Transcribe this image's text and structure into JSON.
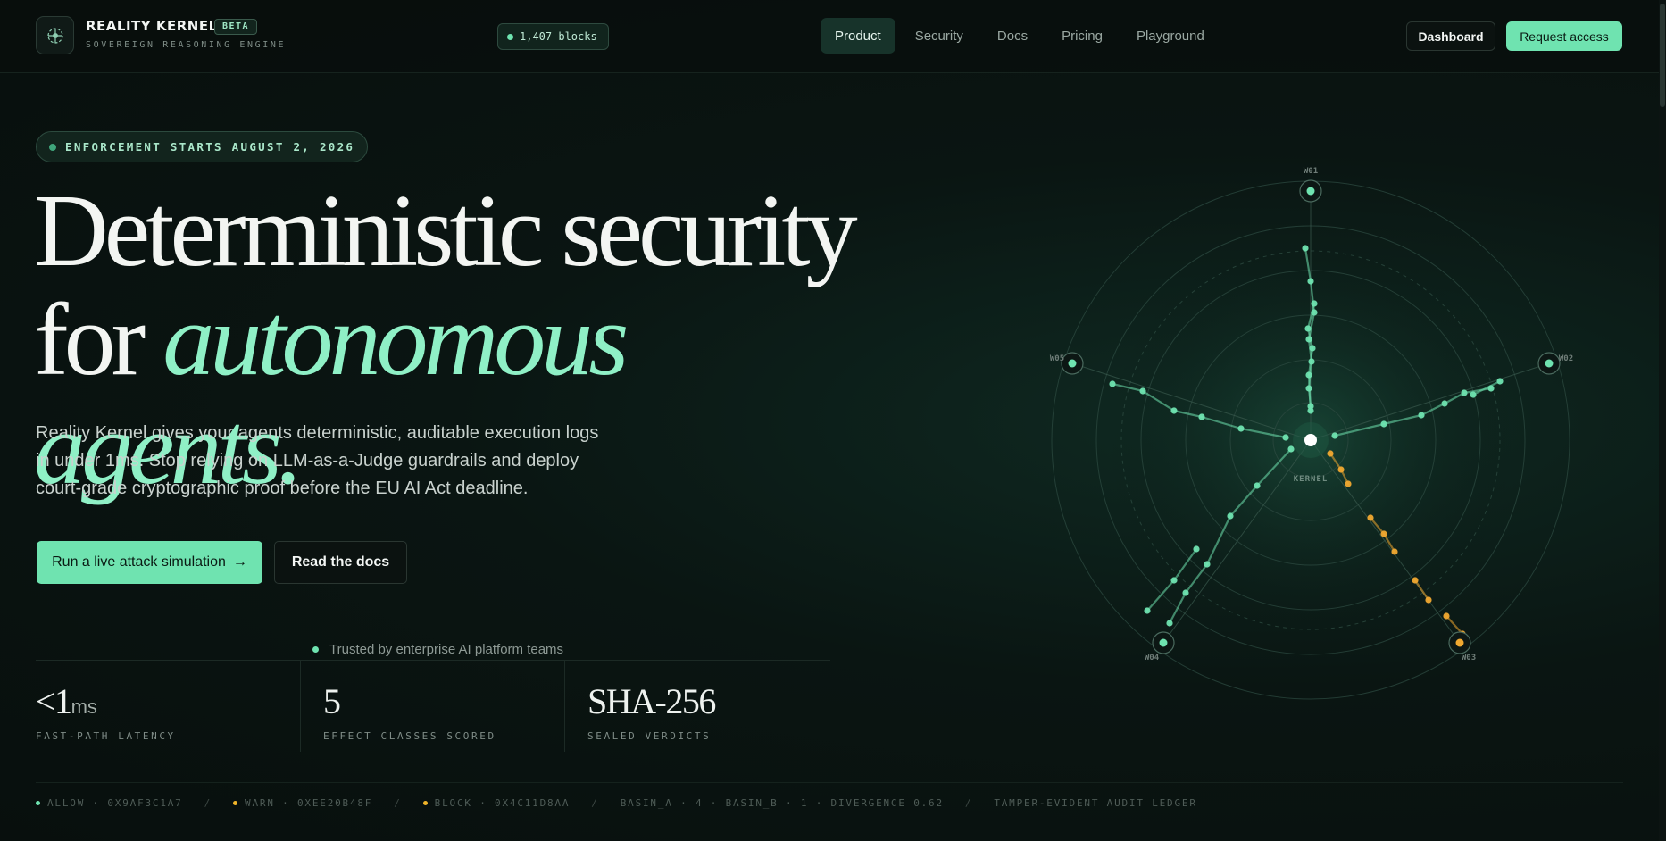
{
  "header": {
    "brand": "REALITY KERNEL",
    "beta": "BETA",
    "tagline": "SOVEREIGN REASONING ENGINE",
    "blocks": "1,407 blocks",
    "nav": [
      {
        "label": "Product",
        "active": true
      },
      {
        "label": "Security",
        "active": false
      },
      {
        "label": "Docs",
        "active": false
      },
      {
        "label": "Pricing",
        "active": false
      },
      {
        "label": "Playground",
        "active": false
      }
    ],
    "dashboard_label": "Dashboard",
    "request_label": "Request access"
  },
  "hero": {
    "badge": "ENFORCEMENT STARTS AUGUST 2, 2026",
    "headline_line1": "Deterministic security",
    "headline_for": "for ",
    "headline_accent": "autonomous agents.",
    "lead": "Reality Kernel gives your agents deterministic, auditable execution logs in under 1ms. Stop relying on LLM-as-a-Judge guardrails and deploy court-grade cryptographic proof before the EU AI Act deadline.",
    "cta_primary": "Run a live attack simulation",
    "cta_primary_arrow": "→",
    "cta_secondary": "Read the docs",
    "trusted": "Trusted by enterprise AI platform teams"
  },
  "stats": [
    {
      "value": "<1",
      "unit": "ms",
      "label": "FAST-PATH LATENCY"
    },
    {
      "value": "5",
      "unit": "",
      "label": "EFFECT CLASSES SCORED"
    },
    {
      "value": "SHA-256",
      "unit": "",
      "label": "SEALED VERDICTS"
    }
  ],
  "ticker": [
    {
      "text": "ALLOW · 0X9AF3C1A7",
      "dot": "#6fe3b0"
    },
    {
      "text": "WARN · 0XEE20B48F",
      "dot": "#f0b429"
    },
    {
      "text": "BLOCK · 0X4C11D8AA",
      "dot": "#f0b429"
    },
    {
      "text": "BASIN_A · 4 · BASIN_B · 1 · DIVERGENCE 0.62",
      "dot": ""
    },
    {
      "text": "TAMPER-EVIDENT AUDIT LEDGER",
      "dot": ""
    }
  ],
  "ticker_sep": "/",
  "radar": {
    "center_label": "KERNEL",
    "nodes": [
      "W01",
      "W02",
      "W03",
      "W04",
      "W05"
    ],
    "colors": {
      "green": "#6fe3b0",
      "amber": "#f0a830",
      "ring": "#2c4a40"
    }
  },
  "colors": {
    "accent": "#6fe3b0",
    "background": "#0a1512",
    "warn": "#f0b429"
  }
}
